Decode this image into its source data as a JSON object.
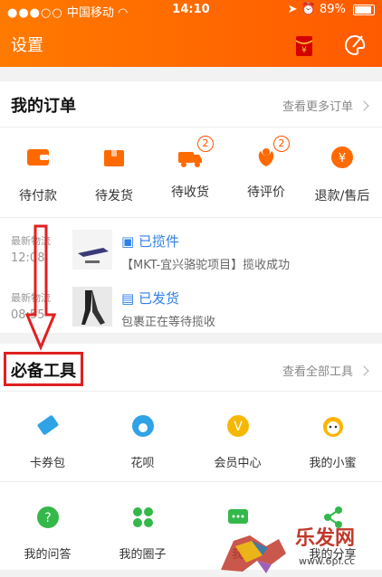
{
  "status": {
    "carrier": "中国移动",
    "time": "14:10",
    "battery": "89%"
  },
  "header": {
    "title": "设置"
  },
  "orders": {
    "title": "我的订单",
    "more": "查看更多订单",
    "items": [
      {
        "label": "待付款",
        "icon": "wallet-icon"
      },
      {
        "label": "待发货",
        "icon": "box-icon"
      },
      {
        "label": "待收货",
        "icon": "truck-icon",
        "badge": "2"
      },
      {
        "label": "待评价",
        "icon": "flower-icon",
        "badge": "2"
      },
      {
        "label": "退款/售后",
        "icon": "yen-icon"
      }
    ],
    "logistics": [
      {
        "meta": "最新物流",
        "time": "12:08",
        "status": "已揽件",
        "desc": "【MKT-宜兴骆驼项目】揽收成功"
      },
      {
        "meta": "最新物流",
        "time": "08:55",
        "status": "已发货",
        "desc": "包裹正在等待揽收"
      }
    ]
  },
  "tools": {
    "title": "必备工具",
    "more": "查看全部工具",
    "items": [
      {
        "label": "卡券包",
        "icon": "ticket-icon"
      },
      {
        "label": "花呗",
        "icon": "huabei-icon"
      },
      {
        "label": "会员中心",
        "icon": "vip-icon"
      },
      {
        "label": "我的小蜜",
        "icon": "assistant-icon"
      },
      {
        "label": "我的问答",
        "icon": "question-icon"
      },
      {
        "label": "我的圈子",
        "icon": "circles-icon"
      },
      {
        "label": "我",
        "icon": "chat-icon"
      },
      {
        "label": "我的分享",
        "icon": "share-icon"
      }
    ]
  },
  "watermark": {
    "text": "乐发网",
    "url": "www.6pf.cc"
  },
  "colors": {
    "accent": "#ff6a00",
    "link_blue": "#2f7fe8",
    "annotation_red": "#e02020"
  }
}
